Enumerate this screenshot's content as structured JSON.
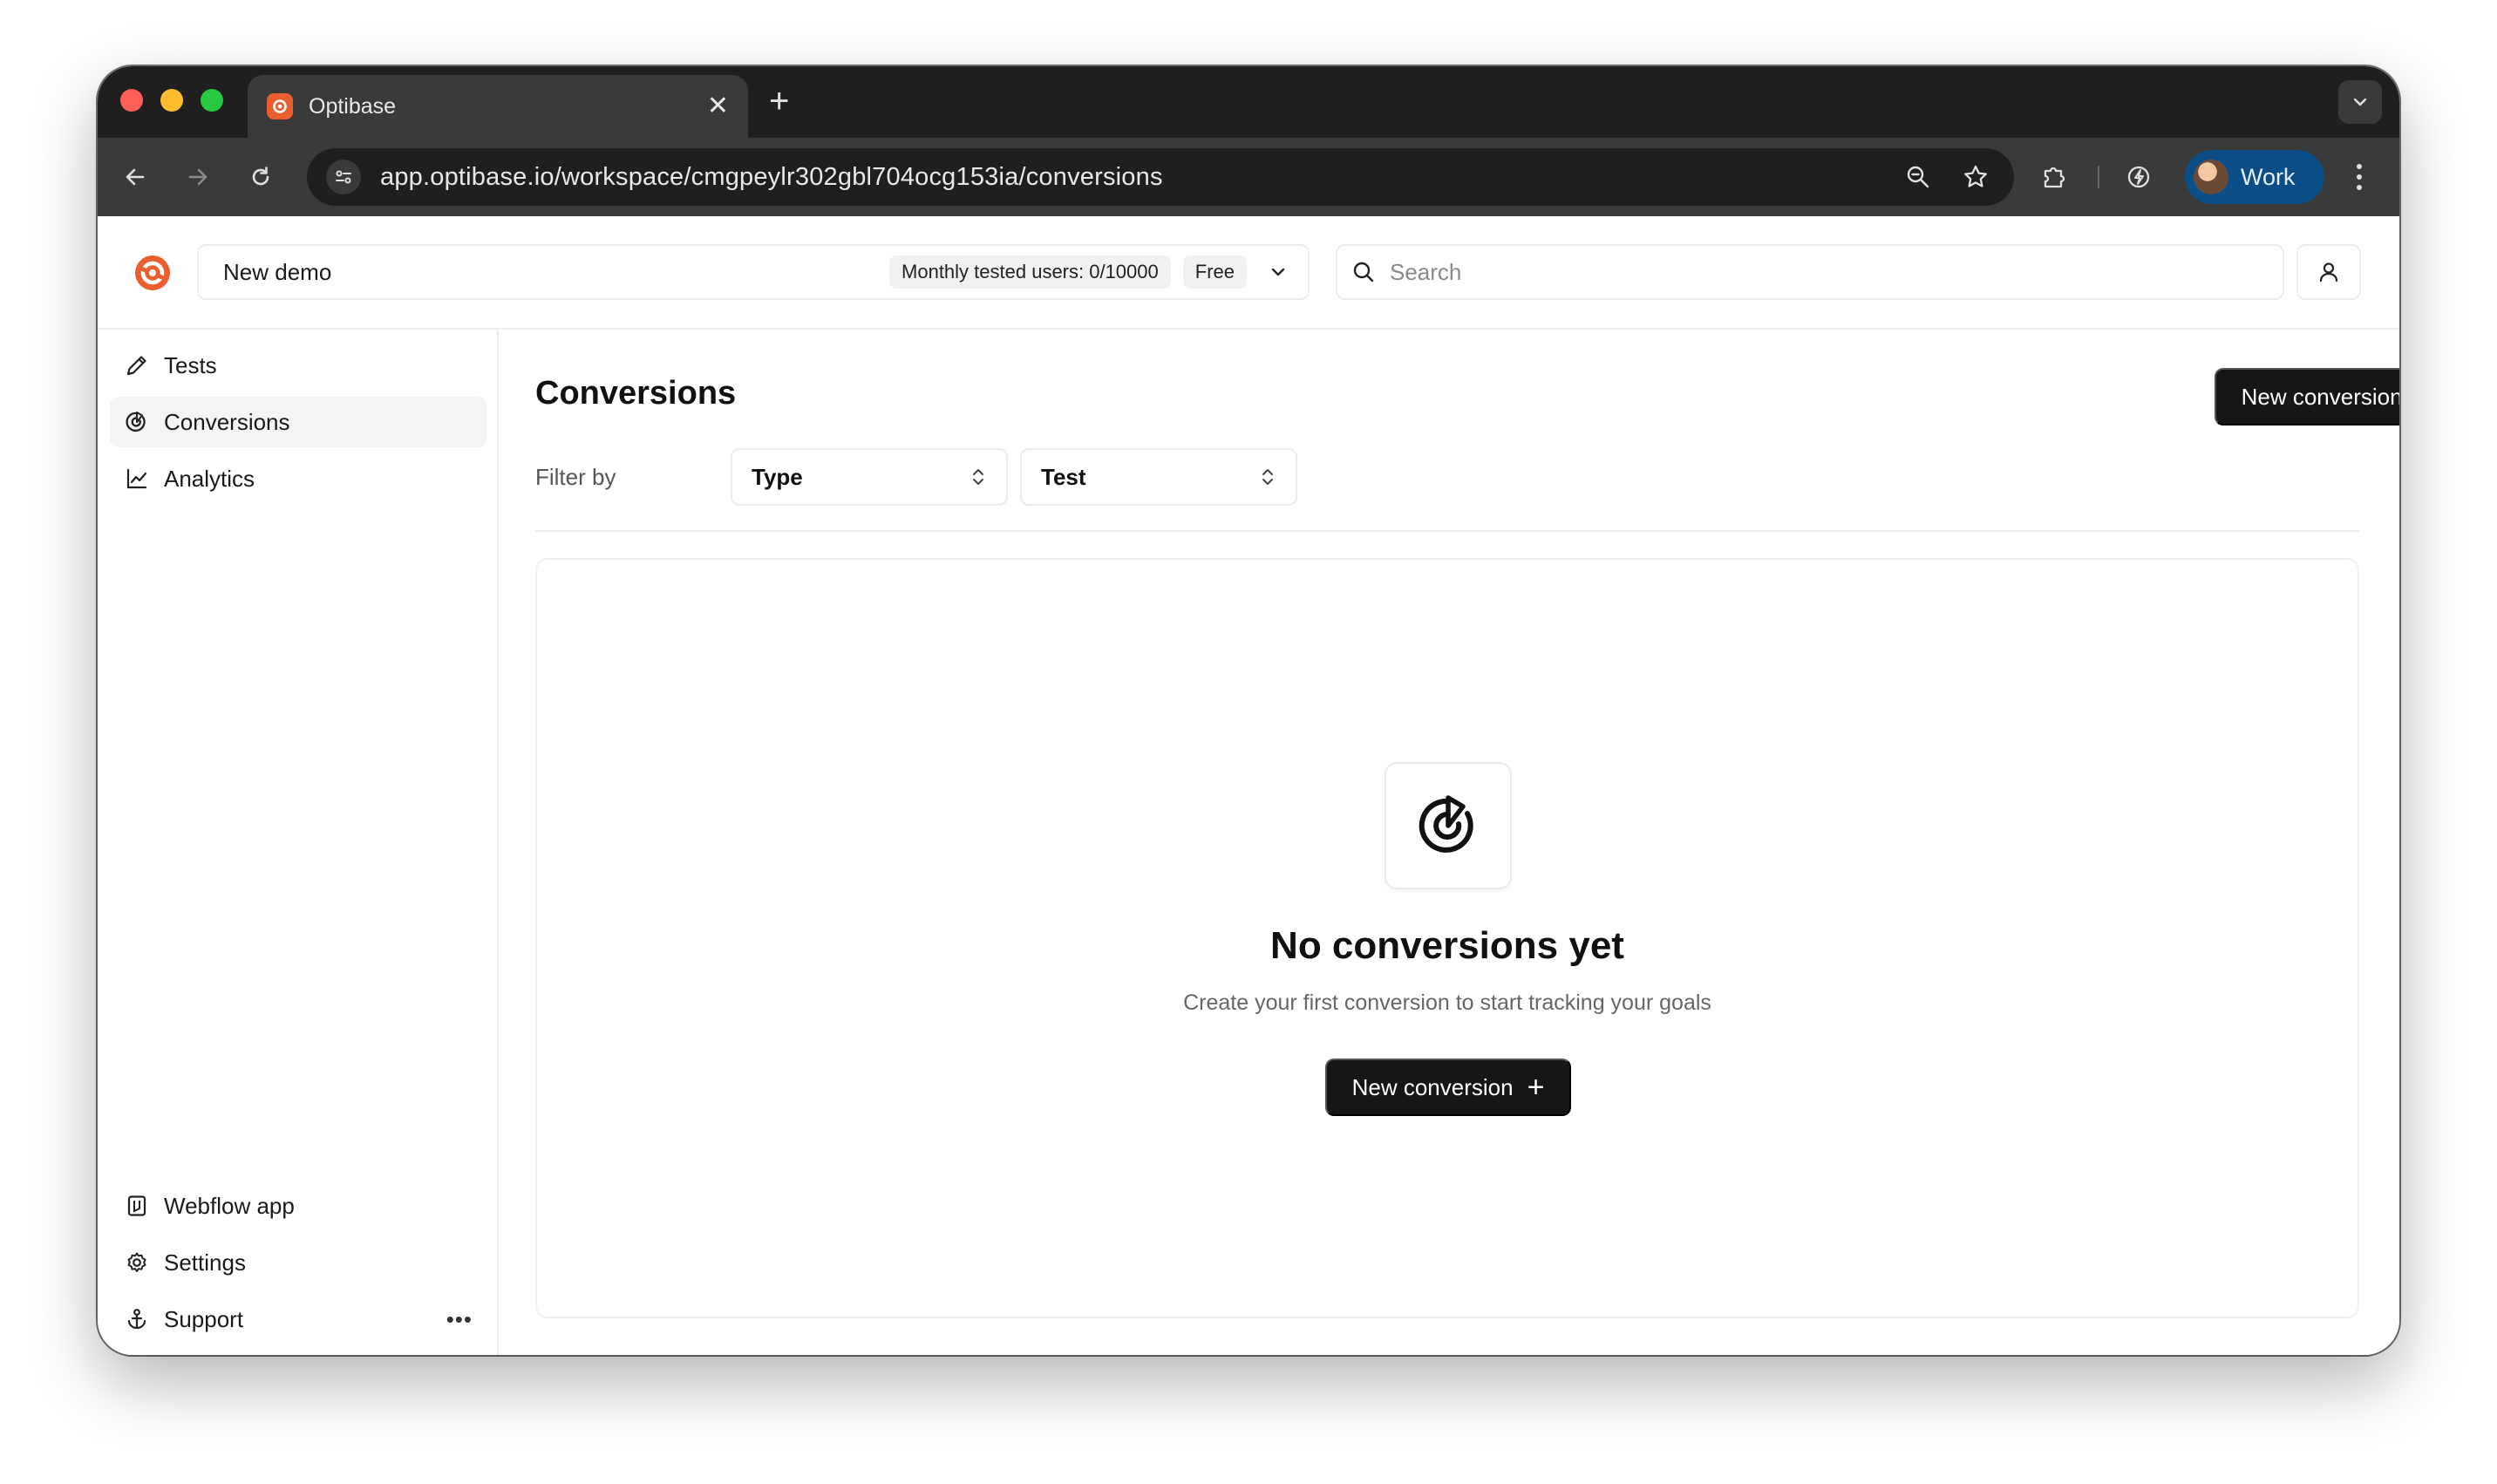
{
  "browser": {
    "tab_title": "Optibase",
    "tab_close": "✕",
    "new_tab": "+",
    "url": "app.optibase.io/workspace/cmgpeylr302gbl704ocg153ia/conversions",
    "profile_label": "Work"
  },
  "header": {
    "workspace_name": "New demo",
    "usage_badge": "Monthly tested users: 0/10000",
    "plan_badge": "Free",
    "search_placeholder": "Search"
  },
  "sidebar": {
    "items": [
      {
        "label": "Tests",
        "icon": "pencil-icon"
      },
      {
        "label": "Conversions",
        "icon": "target-icon",
        "active": true
      },
      {
        "label": "Analytics",
        "icon": "line-chart-icon"
      }
    ],
    "bottom_items": [
      {
        "label": "Webflow app",
        "icon": "webflow-app-icon"
      },
      {
        "label": "Settings",
        "icon": "gear-icon"
      },
      {
        "label": "Support",
        "icon": "anchor-icon"
      }
    ],
    "more": "•••"
  },
  "main": {
    "title": "Conversions",
    "new_button_label": "New conversion",
    "plus": "+",
    "filter_label": "Filter by",
    "filters": [
      {
        "label": "Type"
      },
      {
        "label": "Test"
      }
    ],
    "empty_state": {
      "title": "No conversions yet",
      "description": "Create your first conversion to start tracking your goals",
      "button_label": "New conversion"
    }
  },
  "colors": {
    "brand": "#ea5f2f",
    "button_dark": "#161616",
    "profile_chip": "#0b4d87"
  }
}
